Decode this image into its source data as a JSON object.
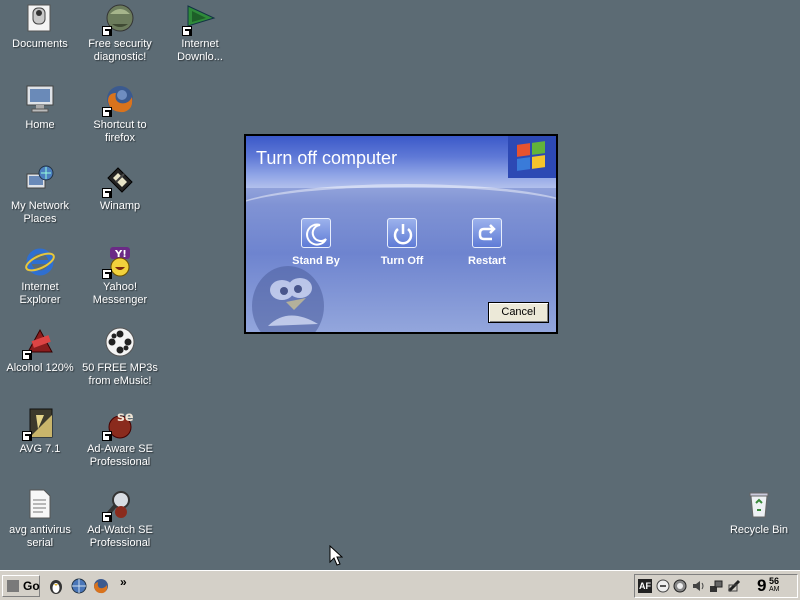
{
  "desktop_icons": [
    {
      "label": "Documents",
      "icon": "documents-icon"
    },
    {
      "label": "Free security diagnostic!",
      "icon": "security-diagnostic-icon"
    },
    {
      "label": "Internet Downlo...",
      "icon": "internet-download-icon"
    },
    {
      "label": "Home",
      "icon": "home-icon"
    },
    {
      "label": "Shortcut to firefox",
      "icon": "firefox-icon"
    },
    {
      "label": "My Network Places",
      "icon": "network-places-icon"
    },
    {
      "label": "Winamp",
      "icon": "winamp-icon"
    },
    {
      "label": "Internet Explorer",
      "icon": "internet-explorer-icon"
    },
    {
      "label": "Yahoo! Messenger",
      "icon": "yahoo-messenger-icon"
    },
    {
      "label": "Alcohol 120%",
      "icon": "alcohol-120-icon"
    },
    {
      "label": "50 FREE MP3s from eMusic!",
      "icon": "emusic-icon"
    },
    {
      "label": "AVG 7.1",
      "icon": "avg-icon"
    },
    {
      "label": "Ad-Aware SE Professional",
      "icon": "ad-aware-icon"
    },
    {
      "label": "avg antivirus serial",
      "icon": "text-document-icon"
    },
    {
      "label": "Ad-Watch SE Professional",
      "icon": "ad-watch-icon"
    },
    {
      "label": "Recycle Bin",
      "icon": "recycle-bin-icon"
    }
  ],
  "dialog": {
    "title": "Turn off computer",
    "actions": [
      {
        "label": "Stand By",
        "icon": "moon-icon"
      },
      {
        "label": "Turn Off",
        "icon": "power-icon"
      },
      {
        "label": "Restart",
        "icon": "restart-icon"
      }
    ],
    "cancel_label": "Cancel"
  },
  "taskbar": {
    "go_label": "Go",
    "more_label": "»",
    "tray_label": "AF",
    "clock_hour": "9",
    "clock_minutes": "56",
    "clock_ampm": "AM"
  },
  "colors": {
    "desktop_bg": "#5c6b74",
    "dialog_blue": "#5f79d6",
    "taskbar_bg": "#d4d0c8"
  }
}
